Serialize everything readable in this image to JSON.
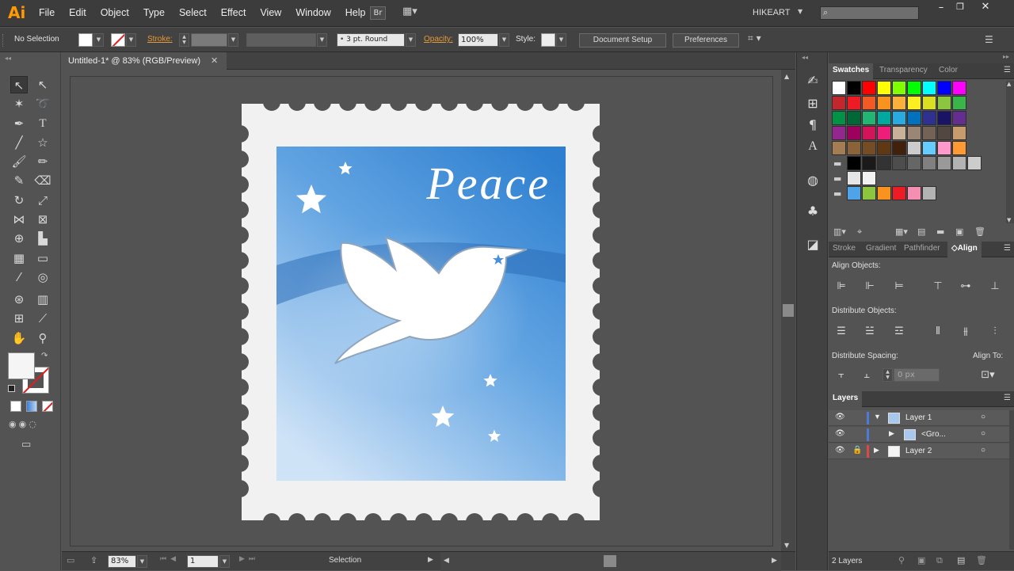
{
  "app": {
    "logo": "Ai",
    "workspace": "HIKEART"
  },
  "menu": [
    "File",
    "Edit",
    "Object",
    "Type",
    "Select",
    "Effect",
    "View",
    "Window",
    "Help"
  ],
  "top_buttons": {
    "bridge": "Br"
  },
  "control": {
    "selection": "No Selection",
    "stroke_label": "Stroke:",
    "brush": "3 pt. Round",
    "opacity_label": "Opacity:",
    "opacity_value": "100%",
    "style_label": "Style:",
    "document_setup": "Document Setup",
    "preferences": "Preferences"
  },
  "document": {
    "tab_title": "Untitled-1* @ 83% (RGB/Preview)"
  },
  "artwork": {
    "text": "Peace",
    "stamp_color": "#f1f1f1",
    "sky_top": "#2e7fd0",
    "sky_bottom": "#cfe3f7"
  },
  "status": {
    "zoom": "83%",
    "artboard": "1",
    "tool": "Selection"
  },
  "panels": {
    "swatch_tabs": [
      "Swatches",
      "Transparency",
      "Color"
    ],
    "align_tabs": [
      "Stroke",
      "Gradient",
      "Pathfinder",
      "Align"
    ],
    "align_objects": "Align Objects:",
    "distribute_objects": "Distribute Objects:",
    "distribute_spacing": "Distribute Spacing:",
    "align_to": "Align To:",
    "spacing_value": "0 px",
    "layers_tab": "Layers",
    "layers": [
      {
        "name": "Layer 1",
        "color": "#4f7bd8"
      },
      {
        "name": "<Gro...",
        "color": "#4f7bd8"
      },
      {
        "name": "Layer 2",
        "color": "#e04646"
      }
    ],
    "layers_count": "2 Layers"
  },
  "swatches": [
    [
      "#ffffff",
      "#000000",
      "#ff0000",
      "#ffff00",
      "#7fff00",
      "#00ff00",
      "#00ffff",
      "#0000ff",
      "#ff00ff"
    ],
    [
      "#c1272d",
      "#ed1c24",
      "#f15a24",
      "#f7931e",
      "#fbb03b",
      "#fcee21",
      "#d9e021",
      "#8cc63f",
      "#39b54a"
    ],
    [
      "#009245",
      "#006837",
      "#22b573",
      "#00a99d",
      "#29abe2",
      "#0071bc",
      "#2e3192",
      "#1b1464",
      "#662d91"
    ],
    [
      "#93278f",
      "#9e005d",
      "#d4145a",
      "#ed1e79",
      "#c7b299",
      "#998675",
      "#736357",
      "#534741",
      "#c69c6d"
    ],
    [
      "#a67c52",
      "#8c6239",
      "#754c24",
      "#603813",
      "#42210b",
      "#cccccc",
      "#66ccff",
      "#ff99cc",
      "#ff9933"
    ],
    [
      "#000000",
      "#1a1a1a",
      "#333333",
      "#4d4d4d",
      "#666666",
      "#808080",
      "#999999",
      "#b3b3b3",
      "#cccccc"
    ],
    [
      "#e6e6e6",
      "#f2f2f2"
    ],
    [
      "#4fa3e8",
      "#8cc63f",
      "#f7931e",
      "#ed1c24",
      "#f48fb1",
      "#b3b3b3"
    ]
  ]
}
